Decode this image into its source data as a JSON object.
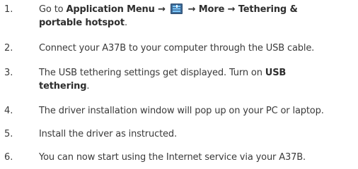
{
  "steps": [
    {
      "number": "1.",
      "prefix": "Go to ",
      "app_menu": "Application Menu",
      "arrow1": " → ",
      "icon": "application-menu-icon",
      "arrow2": " → ",
      "more": "More",
      "arrow3": " → ",
      "line1_bold": "Tethering &",
      "line2_bold": "portable hotspot",
      "line2_end": "."
    },
    {
      "number": "2.",
      "text": "Connect your A37B to your computer through the USB cable."
    },
    {
      "number": "3.",
      "line1_text": "The USB tethering settings get displayed. Turn on ",
      "line1_bold": "USB",
      "line2_bold": "tethering",
      "line2_end": "."
    },
    {
      "number": "4.",
      "text": "The driver installation window will pop up on your PC or laptop."
    },
    {
      "number": "5.",
      "text": "Install the driver as instructed."
    },
    {
      "number": "6.",
      "text": "You can now start using the Internet service via your A37B."
    }
  ],
  "colors": {
    "text": "#3a3a3a",
    "icon_bg": "#2c4a6e",
    "icon_bar": "#7ecbff"
  }
}
